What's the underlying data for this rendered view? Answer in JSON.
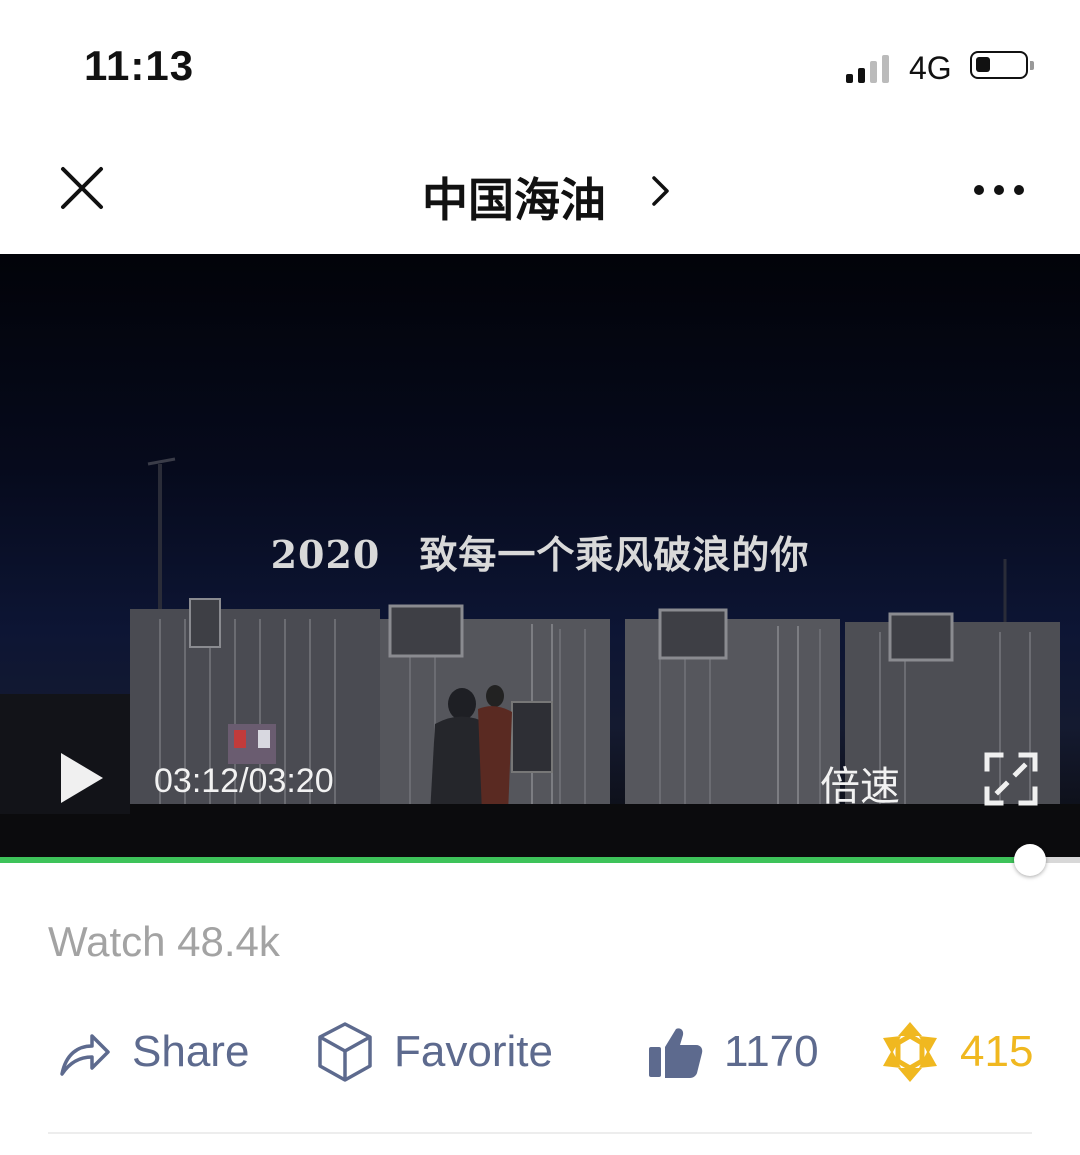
{
  "status_bar": {
    "time": "11:13",
    "network": "4G",
    "battery_level": 0.25
  },
  "nav": {
    "title": "中国海油",
    "close_icon": "close-icon",
    "more_icon": "more-icon"
  },
  "video": {
    "subtitle": "2020　致每一个乘风破浪的你",
    "time_display": "03:12/03:20",
    "speed_label": "倍速",
    "progress_fraction": 0.954,
    "progress_color": "#3ec35a"
  },
  "stats": {
    "watch_text": "Watch 48.4k"
  },
  "actions": {
    "share_label": "Share",
    "favorite_label": "Favorite",
    "like_count": "1170",
    "wow_count": "415",
    "accent_color": "#5d6a8e",
    "wow_color": "#f0b820"
  }
}
